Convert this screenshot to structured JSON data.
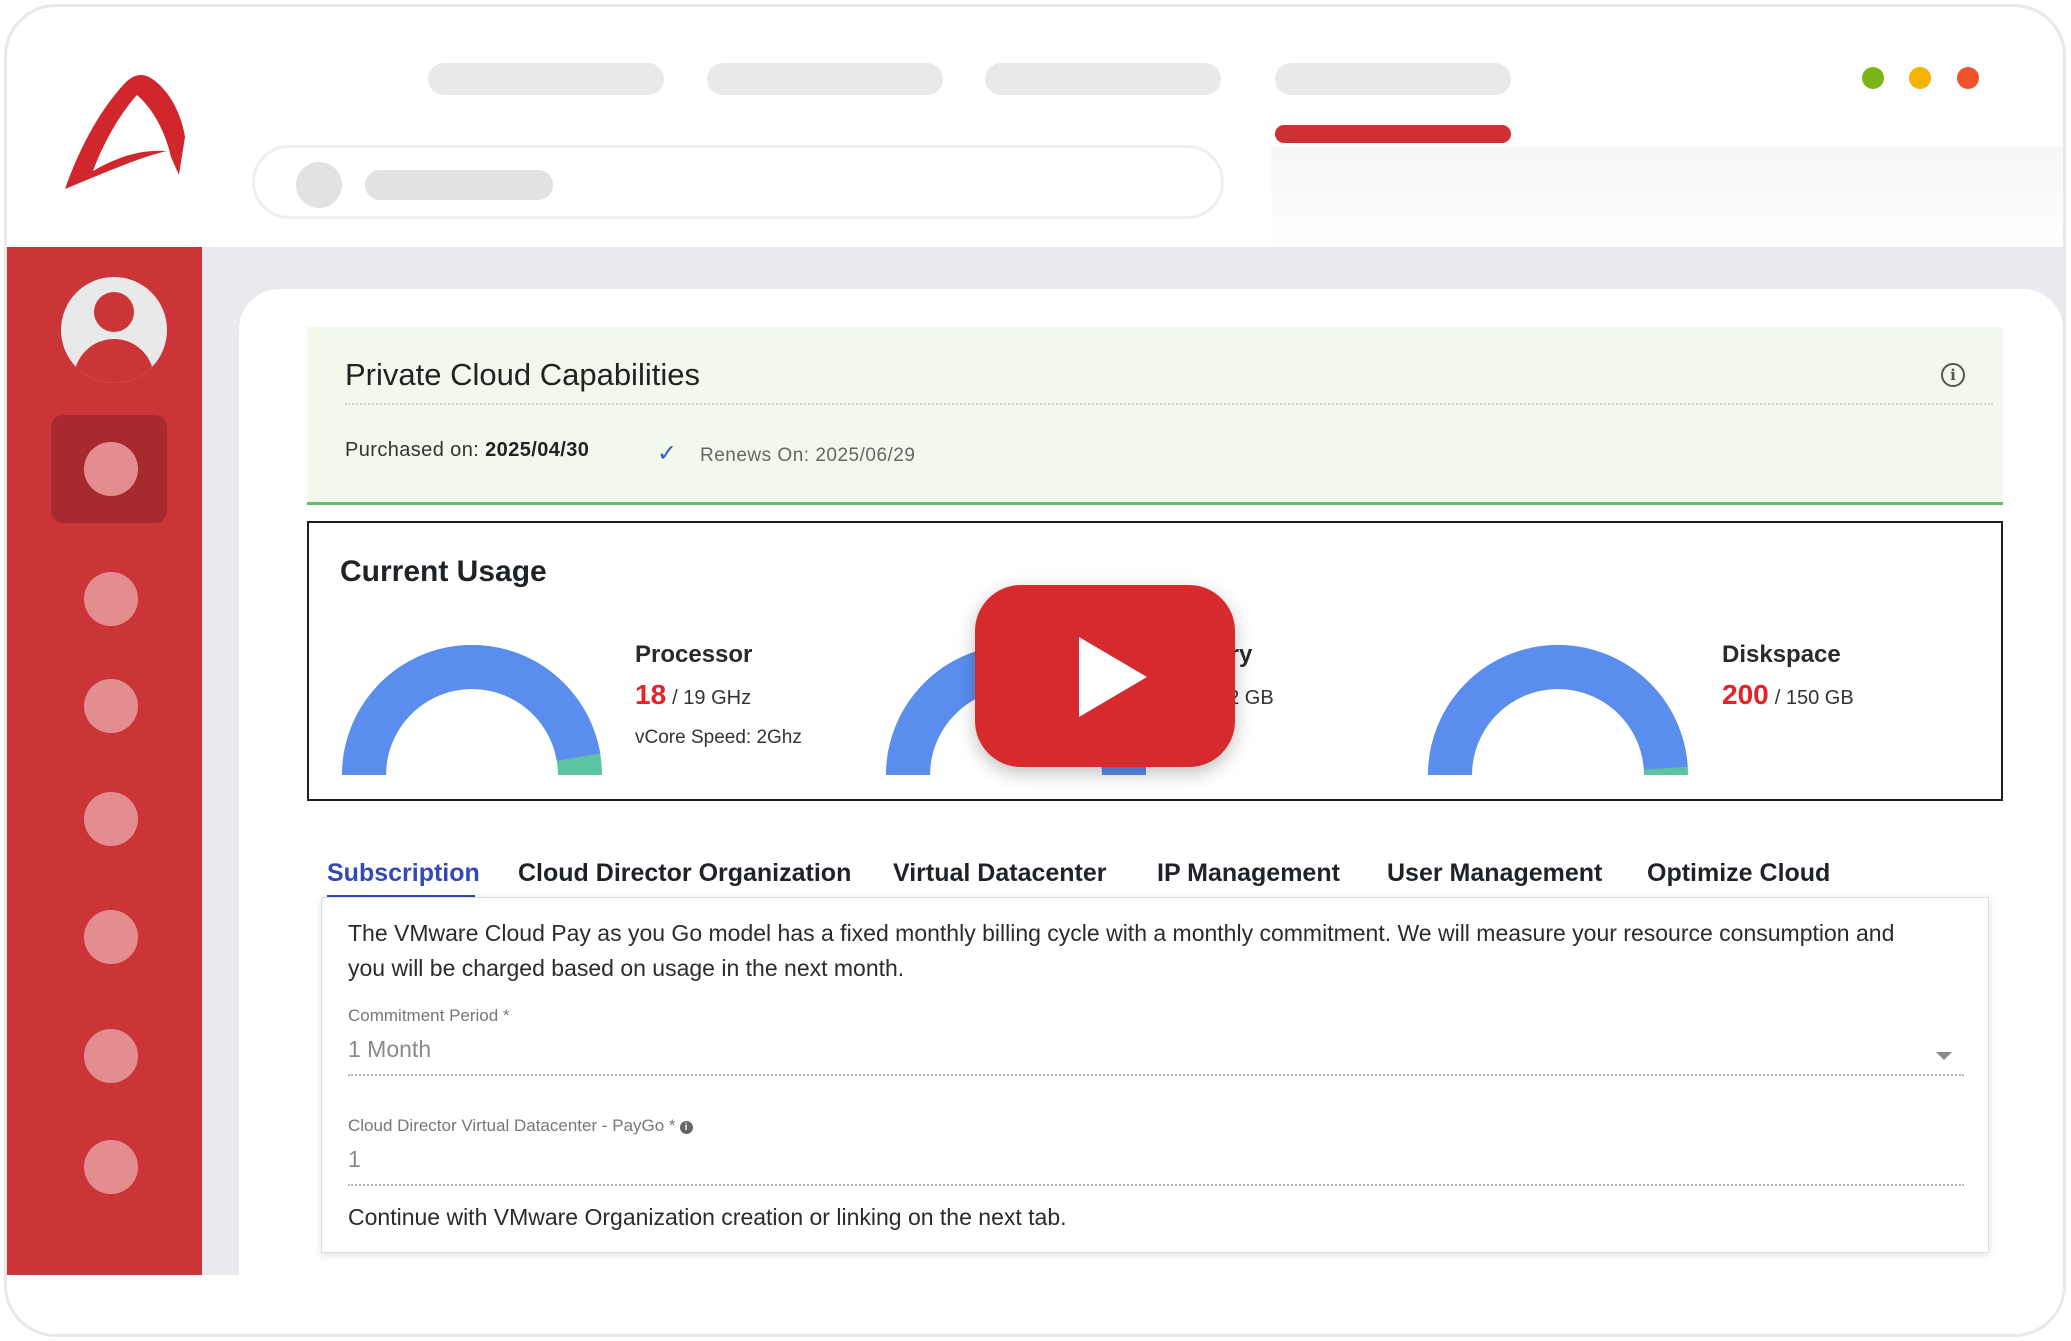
{
  "window": {
    "dots": [
      "#7cb518",
      "#f5b400",
      "#f0522a"
    ]
  },
  "capabilities": {
    "title": "Private Cloud Capabilities",
    "info_icon": "i",
    "purchased_label": "Purchased on:",
    "purchased_date": "2025/04/30",
    "renew_check_icon": "✓",
    "renews": "Renews On: 2025/06/29"
  },
  "usage": {
    "title": "Current Usage",
    "gauges": [
      {
        "label": "Processor",
        "used": "18",
        "max": "/ 19 GHz",
        "sub": "vCore Speed: 2Ghz",
        "used_fraction": 0.947,
        "color": "#5b8def",
        "remain_color": "#5cc4a0"
      },
      {
        "label": "ory",
        "used": "",
        "max": "32 GB",
        "sub": "",
        "used_fraction": 1.0,
        "color": "#5b8def",
        "remain_color": "#5cc4a0"
      },
      {
        "label": "Diskspace",
        "used": "200",
        "max": "/ 150 GB",
        "sub": "",
        "used_fraction": 0.98,
        "color": "#5b8def",
        "remain_color": "#5cc4a0"
      }
    ]
  },
  "tabs": [
    {
      "label": "Subscription",
      "active": true
    },
    {
      "label": "Cloud Director Organization",
      "active": false
    },
    {
      "label": "Virtual Datacenter",
      "active": false
    },
    {
      "label": "IP Management",
      "active": false
    },
    {
      "label": "User Management",
      "active": false
    },
    {
      "label": "Optimize Cloud",
      "active": false
    }
  ],
  "subscription": {
    "description": "The VMware Cloud Pay as you Go model has a fixed monthly billing cycle with a monthly commitment. We will measure your resource consumption and you will be charged based on usage in the next month.",
    "commitment_label": "Commitment Period  *",
    "commitment_value": "1 Month",
    "vdc_label": "Cloud Director Virtual Datacenter - PayGo *",
    "vdc_value": "1",
    "footer": "Continue with VMware Organization creation or linking on the next tab."
  },
  "colors": {
    "brand_red": "#cc3537",
    "accent_blue": "#3349b8",
    "value_red": "#e42228"
  }
}
